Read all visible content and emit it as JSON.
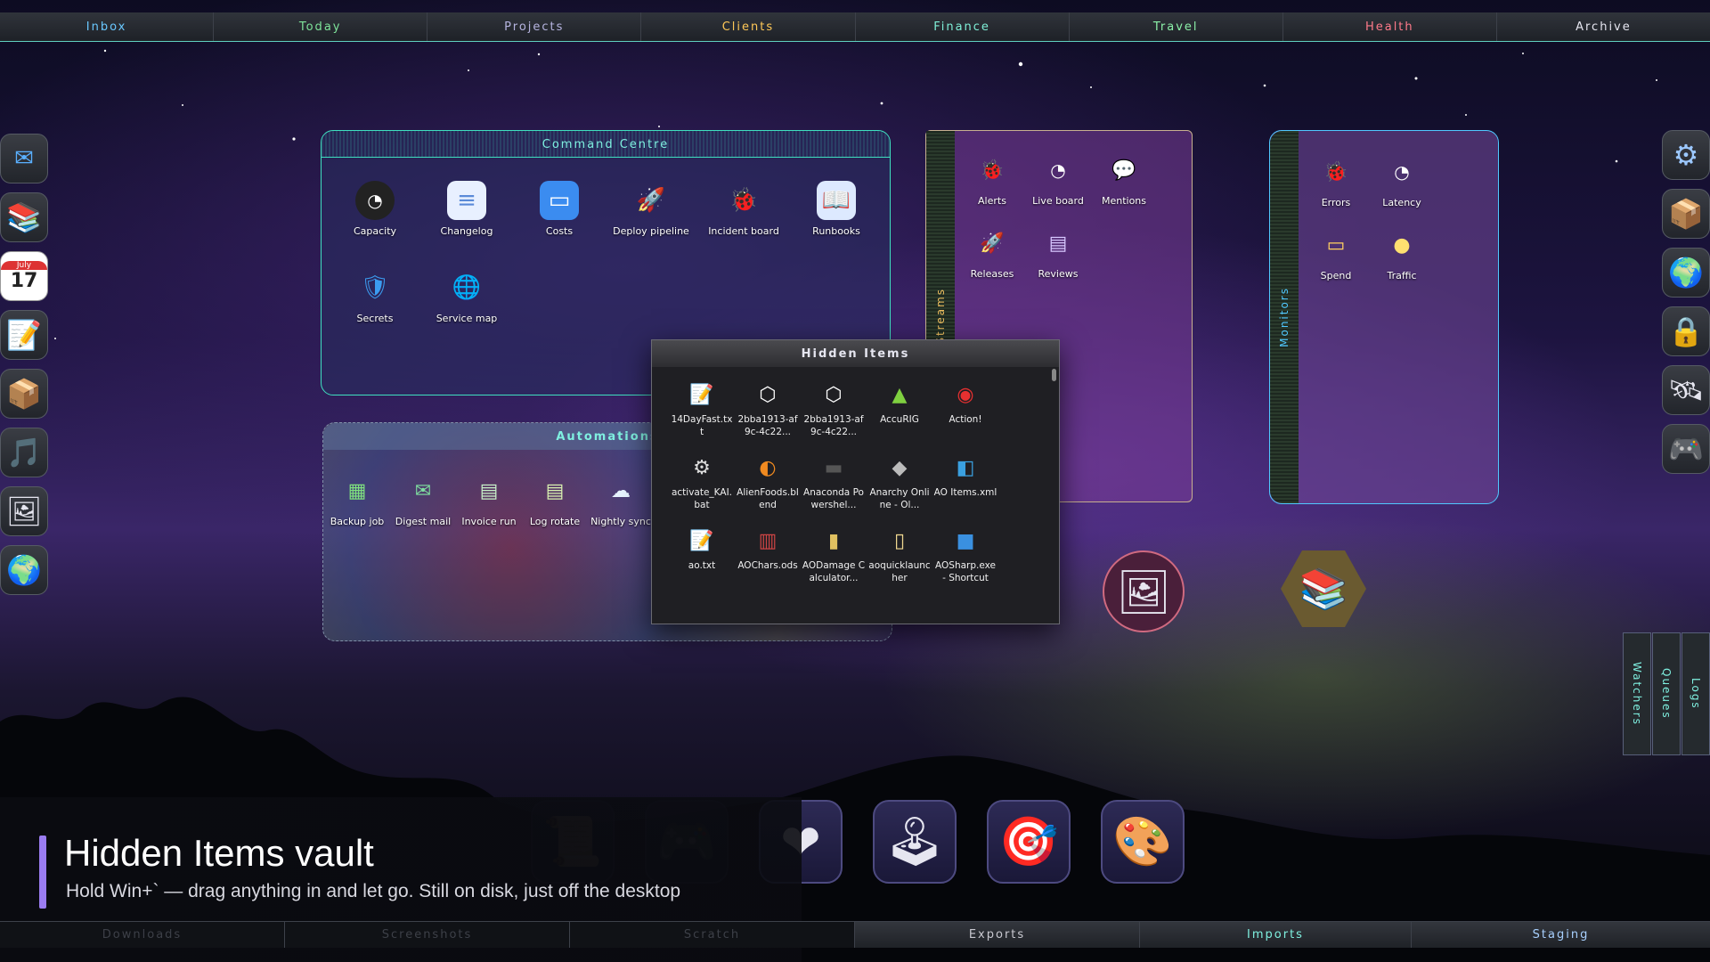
{
  "top_tabs": [
    {
      "label": "Inbox",
      "color": "#6ac8ff"
    },
    {
      "label": "Today",
      "color": "#7ee39a"
    },
    {
      "label": "Projects",
      "color": "#b6b4e0"
    },
    {
      "label": "Clients",
      "color": "#ffc857"
    },
    {
      "label": "Finance",
      "color": "#7ff0d8"
    },
    {
      "label": "Travel",
      "color": "#8bf0a8"
    },
    {
      "label": "Health",
      "color": "#ff7a8a"
    },
    {
      "label": "Archive",
      "color": "#e8e8ee"
    }
  ],
  "left_dock": {
    "icons": [
      "mail-icon",
      "books-icon",
      "calendar-icon",
      "notepad-icon",
      "package-icon",
      "music-icon",
      "picture-icon",
      "globe-icon"
    ],
    "calendar_month": "July",
    "calendar_day": "17"
  },
  "right_dock": {
    "icons": [
      "gear-icon",
      "package-icon",
      "globe-icon",
      "lock-icon",
      "satellite-icon",
      "gamepad-icon"
    ]
  },
  "command_centre": {
    "title": "Command Centre",
    "items": [
      {
        "label": "Capacity",
        "icon": "gauge-icon"
      },
      {
        "label": "Changelog",
        "icon": "document-icon"
      },
      {
        "label": "Costs",
        "icon": "wallet-icon"
      },
      {
        "label": "Deploy pipeline",
        "icon": "rocket-icon"
      },
      {
        "label": "Incident board",
        "icon": "bug-icon"
      },
      {
        "label": "Runbooks",
        "icon": "book-icon"
      },
      {
        "label": "Secrets",
        "icon": "shield-icon"
      },
      {
        "label": "Service map",
        "icon": "globe-icon"
      }
    ]
  },
  "automations": {
    "title": "Automations",
    "items": [
      {
        "label": "Backup job",
        "icon": "calendar-icon"
      },
      {
        "label": "Digest mail",
        "icon": "mail-icon"
      },
      {
        "label": "Invoice run",
        "icon": "document-icon"
      },
      {
        "label": "Log rotate",
        "icon": "document-icon"
      },
      {
        "label": "Nightly sync",
        "icon": "cloud-icon"
      }
    ]
  },
  "streams": {
    "tab_label": "Streams",
    "items": [
      {
        "label": "Alerts",
        "icon": "bug-icon"
      },
      {
        "label": "Live board",
        "icon": "gauge-icon"
      },
      {
        "label": "Mentions",
        "icon": "chat-icon"
      },
      {
        "label": "Releases",
        "icon": "rocket-icon"
      },
      {
        "label": "Reviews",
        "icon": "document-icon"
      }
    ]
  },
  "monitors": {
    "tab_label": "Monitors",
    "items": [
      {
        "label": "Errors",
        "icon": "bug-icon"
      },
      {
        "label": "Latency",
        "icon": "gauge-icon"
      },
      {
        "label": "Spend",
        "icon": "wallet-icon"
      },
      {
        "label": "Traffic",
        "icon": "clock-icon"
      }
    ]
  },
  "hidden_items": {
    "title": "Hidden Items",
    "files": [
      {
        "label": "14DayFast.txt",
        "icon": "text-file-icon"
      },
      {
        "label": "2bba1913-af9c-4c22...",
        "icon": "cube-file-icon"
      },
      {
        "label": "2bba1913-af9c-4c22...",
        "icon": "cube-file-icon"
      },
      {
        "label": "AccuRIG",
        "icon": "accurig-icon"
      },
      {
        "label": "Action!",
        "icon": "action-icon"
      },
      {
        "label": "activate_KAI.bat",
        "icon": "batch-file-icon"
      },
      {
        "label": "AlienFoods.blend",
        "icon": "blender-icon"
      },
      {
        "label": "Anaconda Powershel...",
        "icon": "terminal-icon"
      },
      {
        "label": "Anarchy Online - Ol...",
        "icon": "game-icon"
      },
      {
        "label": "AO Items.xml",
        "icon": "xml-file-icon"
      },
      {
        "label": "ao.txt",
        "icon": "text-file-icon"
      },
      {
        "label": "AOChars.ods",
        "icon": "spreadsheet-icon"
      },
      {
        "label": "AODamage Calculator...",
        "icon": "archive-icon"
      },
      {
        "label": "aoquicklauncher",
        "icon": "folder-file-icon"
      },
      {
        "label": "AOSharp.exe - Shortcut",
        "icon": "shortcut-icon"
      }
    ]
  },
  "vertical_tabs": [
    "Watchers",
    "Queues",
    "Logs"
  ],
  "floating_icons": [
    "picture-icon",
    "books-icon"
  ],
  "bottom_dock": {
    "icons": [
      "scroll-icon",
      "gamepad-icon",
      "heart-icon",
      "joystick-icon",
      "target-icon",
      "palette-icon"
    ]
  },
  "toast": {
    "title": "Hidden Items vault",
    "subtitle": "Hold Win+` — drag anything in and let go. Still on disk, just off the desktop"
  },
  "bottom_tabs": [
    {
      "label": "Downloads",
      "color": "#5a5d66"
    },
    {
      "label": "Screenshots",
      "color": "#5a5d66"
    },
    {
      "label": "Scratch",
      "color": "#5a5d66"
    },
    {
      "label": "Exports",
      "color": "#c8c8d0"
    },
    {
      "label": "Imports",
      "color": "#7ff0e0"
    },
    {
      "label": "Staging",
      "color": "#a8d0ff"
    }
  ]
}
